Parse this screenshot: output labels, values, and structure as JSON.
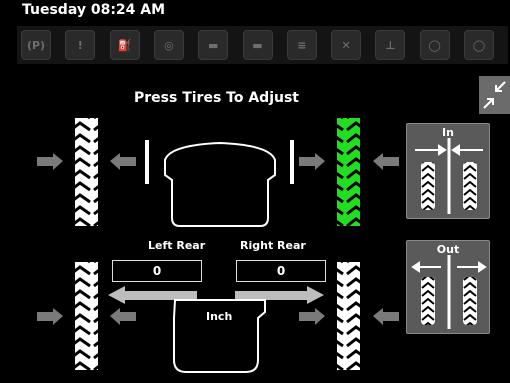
{
  "header": {
    "datetime": "Tuesday 08:24 AM"
  },
  "status_icons": [
    {
      "name": "parking-brake-icon",
      "glyph": "(P)"
    },
    {
      "name": "warning-icon",
      "glyph": "!"
    },
    {
      "name": "fuel-filter-icon",
      "glyph": "⛽"
    },
    {
      "name": "engine-oil-icon",
      "glyph": "◎"
    },
    {
      "name": "engine-warning-icon",
      "glyph": "▬"
    },
    {
      "name": "engine-icon",
      "glyph": "▬"
    },
    {
      "name": "exhaust-icon",
      "glyph": "≡"
    },
    {
      "name": "aftertreatment-disabled-icon",
      "glyph": "✕"
    },
    {
      "name": "hydraulic-icon",
      "glyph": "⊥"
    },
    {
      "name": "transmission-icon",
      "glyph": "◯"
    },
    {
      "name": "filter-icon",
      "glyph": "◯"
    }
  ],
  "main": {
    "instruction": "Press Tires To Adjust",
    "left_rear_label": "Left Rear",
    "right_rear_label": "Right Rear",
    "left_rear_value": "0",
    "right_rear_value": "0",
    "unit": "Inch"
  },
  "toe_in": {
    "label": "In"
  },
  "toe_out": {
    "label": "Out"
  },
  "colors": {
    "selected_tire": "#22dd22",
    "tire": "#ffffff",
    "panel": "#5a5a5a",
    "arrow": "#7a7a7a"
  },
  "selected_tire": "front-right"
}
